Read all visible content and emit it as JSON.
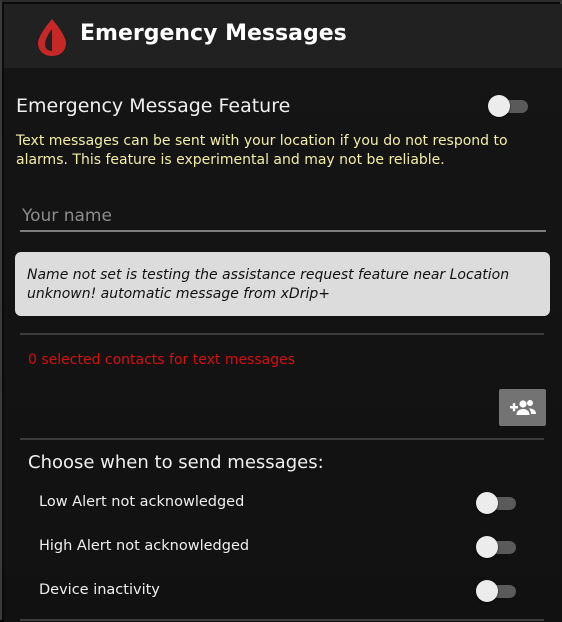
{
  "header": {
    "title": "Emergency Messages",
    "icon": "blood-drop-icon",
    "brand_color": "#c62828"
  },
  "feature": {
    "title": "Emergency Message Feature",
    "enabled": false,
    "description": "Text messages can be sent with your location if you do not respond to alarms. This feature is experimental and may not be reliable."
  },
  "name_field": {
    "placeholder": "Your name",
    "value": ""
  },
  "message_preview": "Name not set is testing the assistance request feature near Location unknown!   automatic message from xDrip+",
  "contacts": {
    "status_text": "0 selected contacts for text messages",
    "add_button_icon": "add-contact-icon"
  },
  "triggers": {
    "title": "Choose when to send messages:",
    "items": [
      {
        "label": "Low Alert not acknowledged",
        "enabled": false
      },
      {
        "label": "High Alert not acknowledged",
        "enabled": false
      },
      {
        "label": "Device inactivity",
        "enabled": false
      }
    ]
  },
  "colors": {
    "description_text": "#f3eea6",
    "warning_text": "#d60f0f",
    "toolbar": "#212121"
  }
}
